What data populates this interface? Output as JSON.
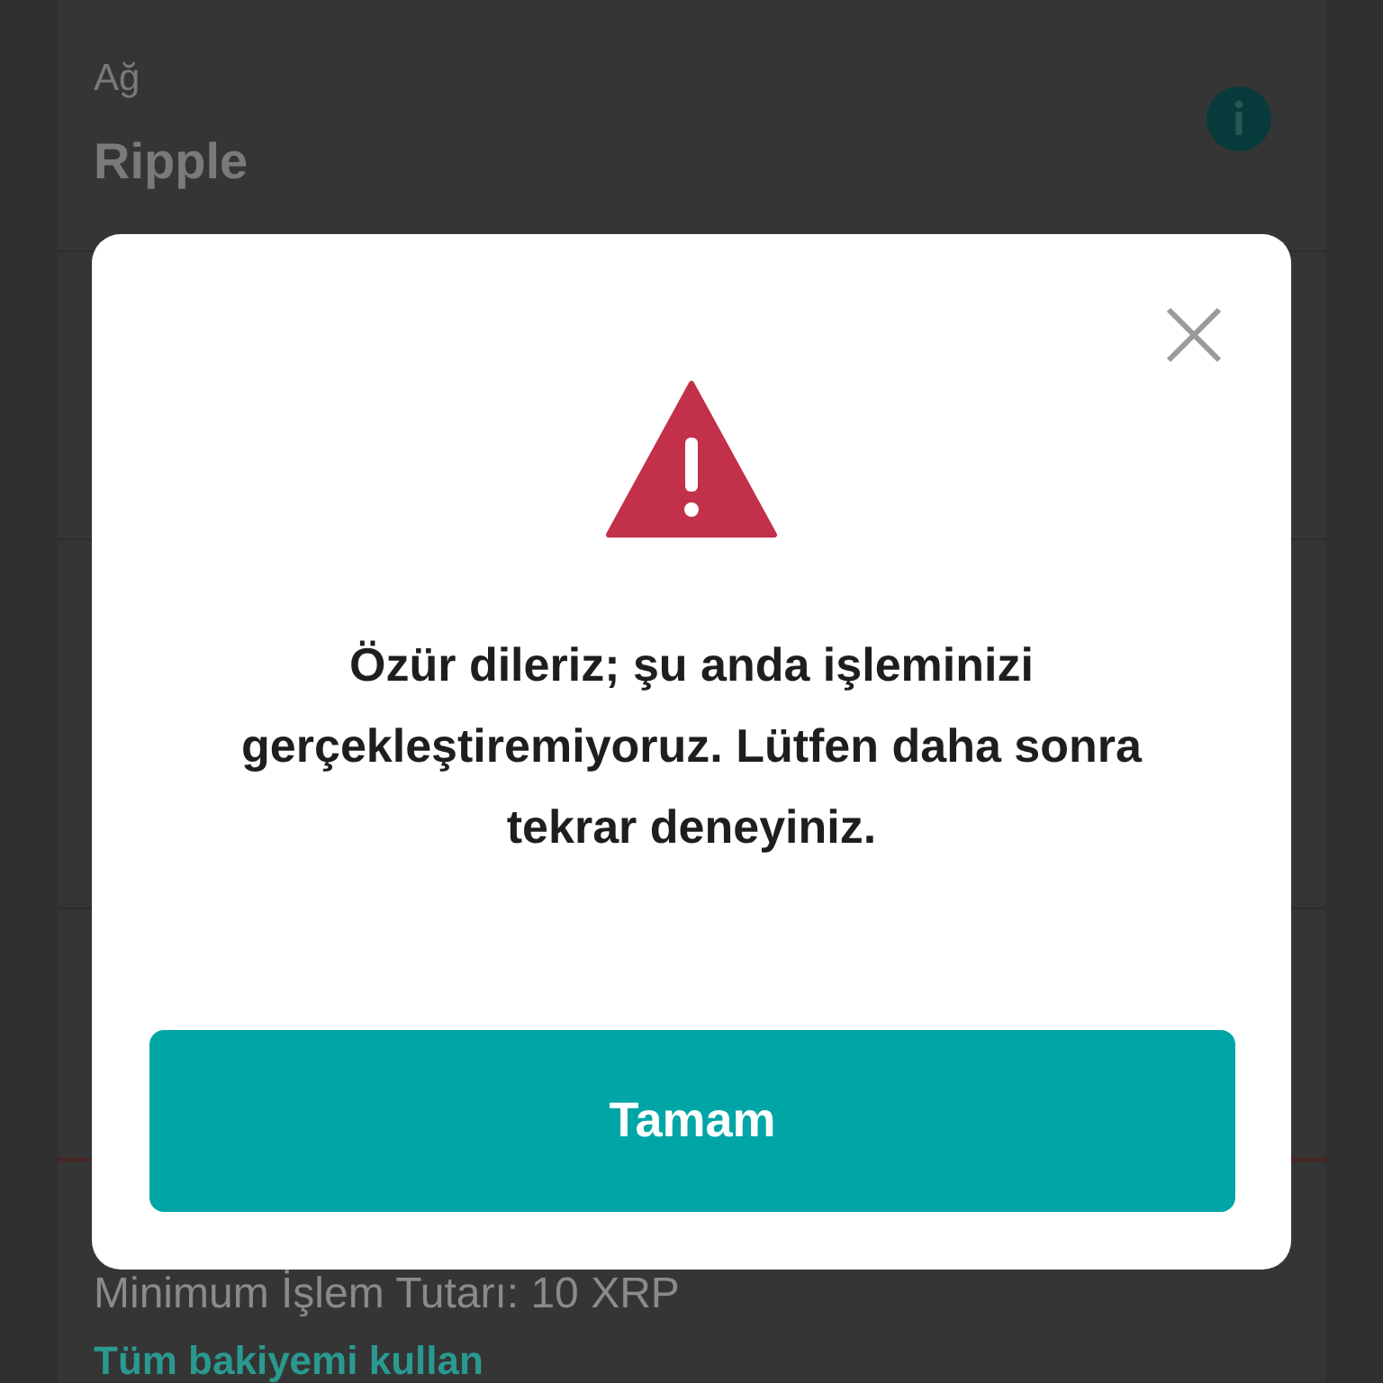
{
  "network_field": {
    "label": "Ağ",
    "value": "Ripple"
  },
  "min_amount": "Minimum İşlem Tutarı: 10 XRP",
  "use_all_link": "Tüm bakiyemi kullan",
  "dialog": {
    "message": "Özür dileriz; şu anda işleminizi gerçekleştiremiyoruz. Lütfen daha sonra tekrar deneyiniz.",
    "button": "Tamam"
  }
}
